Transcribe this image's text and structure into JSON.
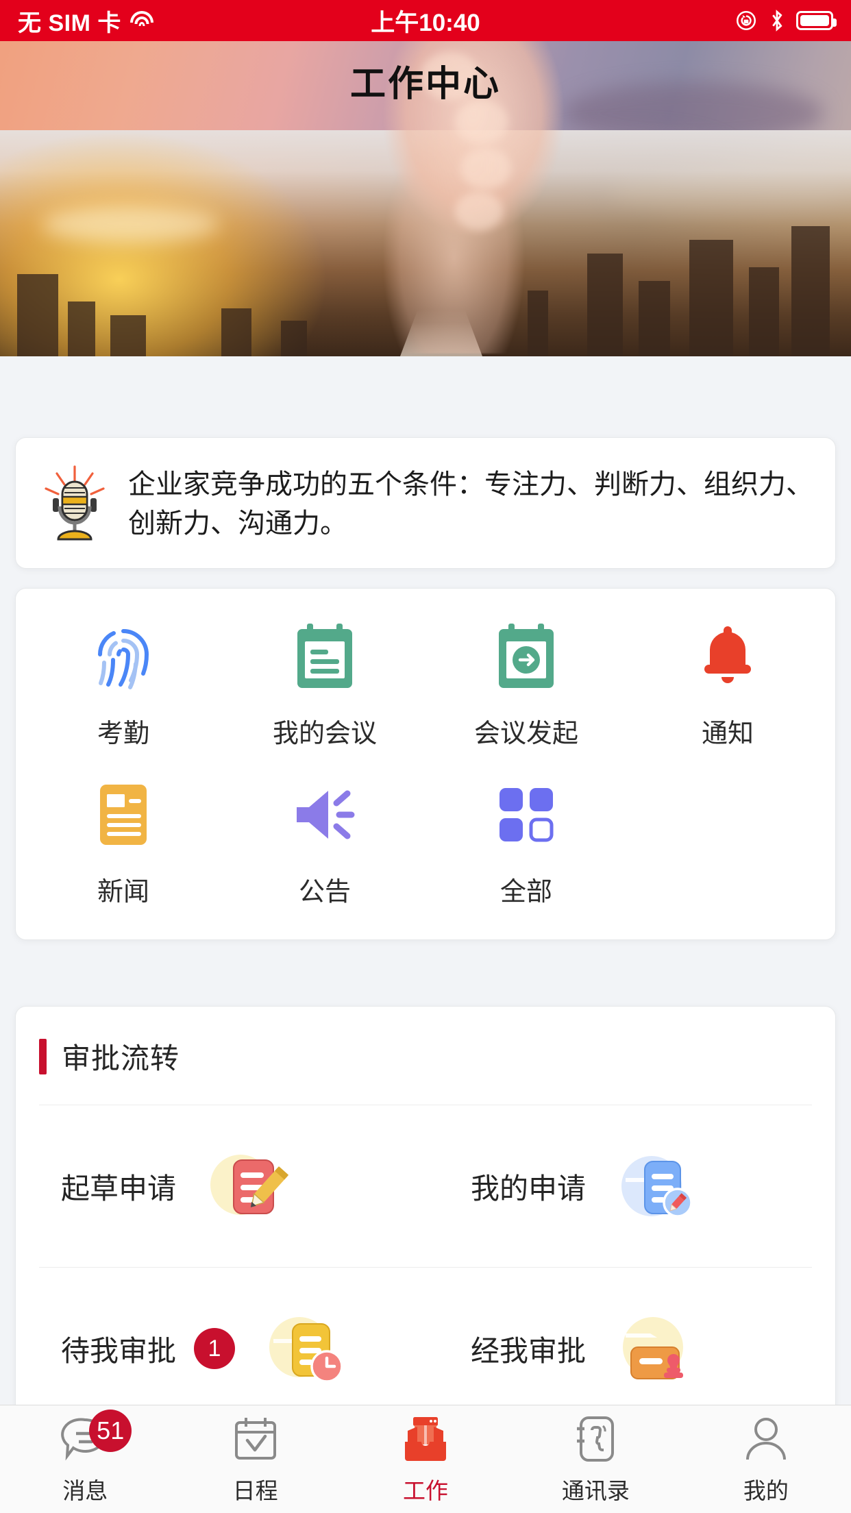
{
  "status_bar": {
    "carrier": "无 SIM 卡",
    "time": "上午10:40",
    "wifi_icon": "wifi-icon",
    "rotation_lock_icon": "rotation-lock-icon",
    "bluetooth_icon": "bluetooth-icon",
    "battery_icon": "battery-icon"
  },
  "header": {
    "title": "工作中心"
  },
  "announcement": {
    "icon": "microphone-icon",
    "text": "企业家竞争成功的五个条件：专注力、判断力、组织力、创新力、沟通力。"
  },
  "apps": [
    {
      "label": "考勤",
      "icon": "fingerprint-icon",
      "color": "#4A86F7"
    },
    {
      "label": "我的会议",
      "icon": "clipboard-icon",
      "color": "#53A98A"
    },
    {
      "label": "会议发起",
      "icon": "calendar-arrow-icon",
      "color": "#53A98A"
    },
    {
      "label": "通知",
      "icon": "bell-icon",
      "color": "#E8402A"
    },
    {
      "label": "新闻",
      "icon": "news-document-icon",
      "color": "#F1B444"
    },
    {
      "label": "公告",
      "icon": "megaphone-icon",
      "color": "#8B7BE8"
    },
    {
      "label": "全部",
      "icon": "grid-apps-icon",
      "color": "#6C6FF0"
    }
  ],
  "approval": {
    "section_title": "审批流转",
    "accent_color": "#C8102E",
    "items": [
      {
        "label": "起草申请",
        "icon": "draft-document-pencil-icon",
        "badge": null
      },
      {
        "label": "我的申请",
        "icon": "my-application-doc-icon",
        "badge": null
      },
      {
        "label": "待我审批",
        "icon": "pending-approval-clock-icon",
        "badge": "1"
      },
      {
        "label": "经我审批",
        "icon": "approved-stamp-icon",
        "badge": null
      }
    ]
  },
  "tabbar": {
    "active_color": "#C8102E",
    "items": [
      {
        "label": "消息",
        "icon": "chat-bubble-icon",
        "badge": "51",
        "active": false
      },
      {
        "label": "日程",
        "icon": "calendar-check-icon",
        "badge": null,
        "active": false
      },
      {
        "label": "工作",
        "icon": "briefcase-icon",
        "badge": null,
        "active": true
      },
      {
        "label": "通讯录",
        "icon": "phonebook-icon",
        "badge": null,
        "active": false
      },
      {
        "label": "我的",
        "icon": "person-icon",
        "badge": null,
        "active": false
      }
    ]
  }
}
